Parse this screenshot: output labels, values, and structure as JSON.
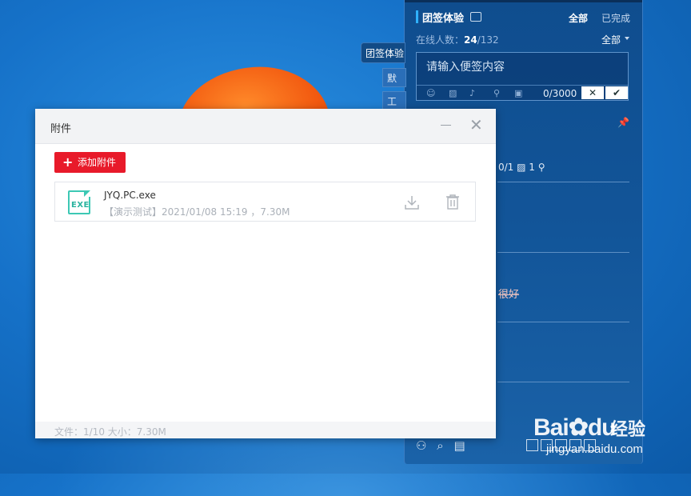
{
  "panel": {
    "title": "团签体验",
    "tabs": [
      "全部",
      "已完成"
    ],
    "online_label": "在线人数：",
    "online_count": "24",
    "online_total": "/132",
    "filter": "全部",
    "input_placeholder": "请输入便签内容",
    "char_count": "0/3000",
    "cancel_symbol": "✕",
    "confirm_symbol": "✔",
    "task_meta": "0/1",
    "attachment_count": "1",
    "strike_text": "很好"
  },
  "menu": {
    "head": "团签体验",
    "items": [
      "默认",
      "工作"
    ]
  },
  "dialog": {
    "title": "附件",
    "add_button": "添加附件",
    "file": {
      "icon_text": "EXE",
      "name": "JYQ.PC.exe",
      "meta": "【演示测试】2021/01/08 15:19 ，7.30M"
    },
    "footer": "文件：1/10   大小：7.30M"
  },
  "watermark": {
    "brand": "Bai",
    "brand2": "du",
    "suffix": "经验",
    "url": "jingyan.baidu.com"
  }
}
